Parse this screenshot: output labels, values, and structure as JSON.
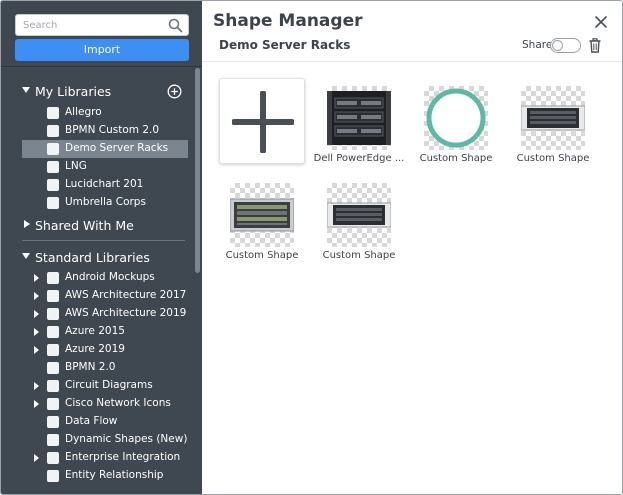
{
  "sidebar": {
    "search_placeholder": "Search",
    "import_label": "Import",
    "my_libraries": {
      "title": "My Libraries",
      "items": [
        {
          "label": "Allegro"
        },
        {
          "label": "BPMN Custom 2.0"
        },
        {
          "label": "Demo Server Racks",
          "selected": true
        },
        {
          "label": "LNG"
        },
        {
          "label": "Lucidchart 201"
        },
        {
          "label": "Umbrella Corps"
        }
      ]
    },
    "shared_with_me": {
      "title": "Shared With Me"
    },
    "standard_libraries": {
      "title": "Standard Libraries",
      "items": [
        {
          "label": "Android Mockups",
          "expandable": true
        },
        {
          "label": "AWS Architecture 2017",
          "expandable": true
        },
        {
          "label": "AWS Architecture 2019",
          "expandable": true
        },
        {
          "label": "Azure 2015",
          "expandable": true
        },
        {
          "label": "Azure 2019",
          "expandable": true
        },
        {
          "label": "BPMN 2.0",
          "expandable": false
        },
        {
          "label": "Circuit Diagrams",
          "expandable": true
        },
        {
          "label": "Cisco Network Icons",
          "expandable": true
        },
        {
          "label": "Data Flow",
          "expandable": false
        },
        {
          "label": "Dynamic Shapes (New)",
          "expandable": false
        },
        {
          "label": "Enterprise Integration",
          "expandable": true
        },
        {
          "label": "Entity Relationship",
          "expandable": false
        }
      ]
    }
  },
  "main": {
    "title": "Shape Manager",
    "library_name": "Demo Server Racks",
    "share_label": "Share",
    "share_enabled": false,
    "shapes": [
      {
        "caption": "Dell PowerEdge ...",
        "icon": "server-rack-icon"
      },
      {
        "caption": "Custom Shape",
        "icon": "circle-outline-icon"
      },
      {
        "caption": "Custom Shape",
        "icon": "server-unit-icon"
      },
      {
        "caption": "Custom Shape",
        "icon": "server-unit-icon"
      },
      {
        "caption": "Custom Shape",
        "icon": "server-unit-icon"
      }
    ]
  },
  "colors": {
    "sidebar_bg": "#3f4750",
    "accent": "#3d8ef5",
    "selected_row": "#7b8590",
    "ring": "#5fb8a4"
  }
}
